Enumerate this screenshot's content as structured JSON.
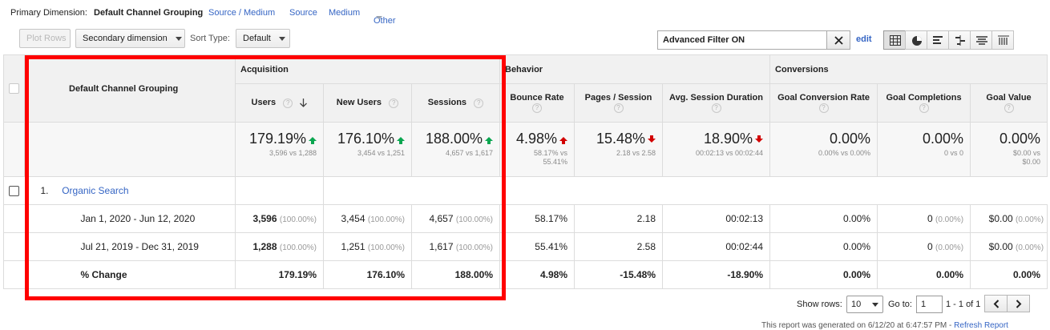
{
  "dimension_bar": {
    "label": "Primary Dimension:",
    "active": "Default Channel Grouping",
    "options": [
      "Source / Medium",
      "Source",
      "Medium",
      "Other"
    ]
  },
  "toolbar": {
    "plot_rows": "Plot Rows",
    "secondary_dimension": "Secondary dimension",
    "sort_type_label": "Sort Type:",
    "sort_type_value": "Default",
    "advanced_filter": "Advanced Filter ON",
    "edit": "edit"
  },
  "table": {
    "dimension_header": "Default Channel Grouping",
    "groups": {
      "acquisition": "Acquisition",
      "behavior": "Behavior",
      "conversions": "Conversions"
    },
    "columns": [
      "Users",
      "New Users",
      "Sessions",
      "Bounce Rate",
      "Pages / Session",
      "Avg. Session Duration",
      "Goal Conversion Rate",
      "Goal Completions",
      "Goal Value"
    ],
    "help_glyph": "?",
    "totals": [
      {
        "big": "179.19%",
        "small": "3,596 vs 1,288",
        "trend": "up"
      },
      {
        "big": "176.10%",
        "small": "3,454 vs 1,251",
        "trend": "up"
      },
      {
        "big": "188.00%",
        "small": "4,657 vs 1,617",
        "trend": "up"
      },
      {
        "big": "4.98%",
        "small": "58.17% vs 55.41%",
        "trend": "up-red"
      },
      {
        "big": "15.48%",
        "small": "2.18 vs 2.58",
        "trend": "down"
      },
      {
        "big": "18.90%",
        "small": "00:02:13 vs 00:02:44",
        "trend": "down"
      },
      {
        "big": "0.00%",
        "small": "0.00% vs 0.00%",
        "trend": "none"
      },
      {
        "big": "0.00%",
        "small": "0 vs 0",
        "trend": "none"
      },
      {
        "big": "0.00%",
        "small": "$0.00 vs $0.00",
        "trend": "none"
      }
    ],
    "channel_row": {
      "index": "1.",
      "name": "Organic Search"
    },
    "rows": [
      {
        "label": "Jan 1, 2020 - Jun 12, 2020",
        "users": "3,596",
        "users_pct": "(100.00%)",
        "new_users": "3,454",
        "new_users_pct": "(100.00%)",
        "sessions": "4,657",
        "sessions_pct": "(100.00%)",
        "bounce": "58.17%",
        "pages": "2.18",
        "duration": "00:02:13",
        "conv_rate": "0.00%",
        "completions": "0",
        "completions_pct": "(0.00%)",
        "value": "$0.00",
        "value_pct": "(0.00%)"
      },
      {
        "label": "Jul 21, 2019 - Dec 31, 2019",
        "users": "1,288",
        "users_pct": "(100.00%)",
        "new_users": "1,251",
        "new_users_pct": "(100.00%)",
        "sessions": "1,617",
        "sessions_pct": "(100.00%)",
        "bounce": "55.41%",
        "pages": "2.58",
        "duration": "00:02:44",
        "conv_rate": "0.00%",
        "completions": "0",
        "completions_pct": "(0.00%)",
        "value": "$0.00",
        "value_pct": "(0.00%)"
      }
    ],
    "change_row": {
      "label": "% Change",
      "values": [
        "179.19%",
        "176.10%",
        "188.00%",
        "4.98%",
        "-15.48%",
        "-18.90%",
        "0.00%",
        "0.00%",
        "0.00%"
      ]
    }
  },
  "footer": {
    "show_rows_label": "Show rows:",
    "show_rows_value": "10",
    "goto_label": "Go to:",
    "goto_value": "1",
    "range": "1 - 1 of 1",
    "generated": "This report was generated on 6/12/20 at 6:47:57 PM - ",
    "refresh": "Refresh Report"
  },
  "colors": {
    "link": "#3565c4",
    "highlight": "#ff0000",
    "up": "#0aa650",
    "down": "#d20000"
  }
}
